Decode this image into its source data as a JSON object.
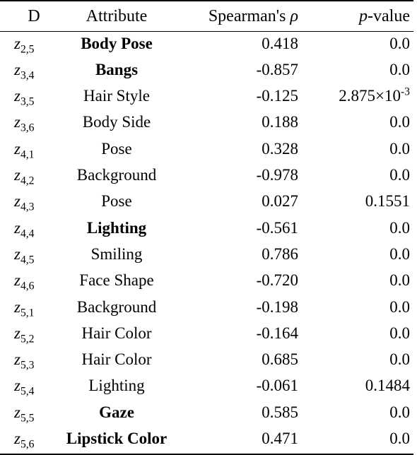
{
  "table": {
    "columns": [
      {
        "key": "dim",
        "label": "D",
        "align": "center"
      },
      {
        "key": "attr",
        "label": "Attribute",
        "align": "center"
      },
      {
        "key": "rho",
        "label": "Spearman's ρ",
        "align": "right"
      },
      {
        "key": "pval",
        "label": "p-value",
        "align": "right"
      }
    ],
    "header": {
      "dim": "D",
      "attribute": "Attribute",
      "spearman_prefix": "Spearman's ",
      "spearman_symbol": "ρ",
      "pvalue_italic": "p",
      "pvalue_rest": "-value"
    },
    "rows": [
      {
        "dim_base": "z",
        "dim_sub": "2,5",
        "attribute": "Body Pose",
        "bold": true,
        "rho": "0.418",
        "pval": "0.0",
        "pval_sci": false
      },
      {
        "dim_base": "z",
        "dim_sub": "3,4",
        "attribute": "Bangs",
        "bold": true,
        "rho": "-0.857",
        "pval": "0.0",
        "pval_sci": false
      },
      {
        "dim_base": "z",
        "dim_sub": "3,5",
        "attribute": "Hair Style",
        "bold": false,
        "rho": "-0.125",
        "pval": "2.875×10⁻³",
        "pval_sci": true,
        "pval_mantissa": "2.875",
        "pval_base": "×10",
        "pval_exp": "-3"
      },
      {
        "dim_base": "z",
        "dim_sub": "3,6",
        "attribute": "Body Side",
        "bold": false,
        "rho": "0.188",
        "pval": "0.0",
        "pval_sci": false
      },
      {
        "dim_base": "z",
        "dim_sub": "4,1",
        "attribute": "Pose",
        "bold": false,
        "rho": "0.328",
        "pval": "0.0",
        "pval_sci": false
      },
      {
        "dim_base": "z",
        "dim_sub": "4,2",
        "attribute": "Background",
        "bold": false,
        "rho": "-0.978",
        "pval": "0.0",
        "pval_sci": false
      },
      {
        "dim_base": "z",
        "dim_sub": "4,3",
        "attribute": "Pose",
        "bold": false,
        "rho": "0.027",
        "pval": "0.1551",
        "pval_sci": false
      },
      {
        "dim_base": "z",
        "dim_sub": "4,4",
        "attribute": "Lighting",
        "bold": true,
        "rho": "-0.561",
        "pval": "0.0",
        "pval_sci": false
      },
      {
        "dim_base": "z",
        "dim_sub": "4,5",
        "attribute": "Smiling",
        "bold": false,
        "rho": "0.786",
        "pval": "0.0",
        "pval_sci": false
      },
      {
        "dim_base": "z",
        "dim_sub": "4,6",
        "attribute": "Face Shape",
        "bold": false,
        "rho": "-0.720",
        "pval": "0.0",
        "pval_sci": false
      },
      {
        "dim_base": "z",
        "dim_sub": "5,1",
        "attribute": "Background",
        "bold": false,
        "rho": "-0.198",
        "pval": "0.0",
        "pval_sci": false
      },
      {
        "dim_base": "z",
        "dim_sub": "5,2",
        "attribute": "Hair Color",
        "bold": false,
        "rho": "-0.164",
        "pval": "0.0",
        "pval_sci": false
      },
      {
        "dim_base": "z",
        "dim_sub": "5,3",
        "attribute": "Hair Color",
        "bold": false,
        "rho": "0.685",
        "pval": "0.0",
        "pval_sci": false
      },
      {
        "dim_base": "z",
        "dim_sub": "5,4",
        "attribute": "Lighting",
        "bold": false,
        "rho": "-0.061",
        "pval": "0.1484",
        "pval_sci": false
      },
      {
        "dim_base": "z",
        "dim_sub": "5,5",
        "attribute": "Gaze",
        "bold": true,
        "rho": "0.585",
        "pval": "0.0",
        "pval_sci": false
      },
      {
        "dim_base": "z",
        "dim_sub": "5,6",
        "attribute": "Lipstick Color",
        "bold": true,
        "rho": "0.471",
        "pval": "0.0",
        "pval_sci": false
      }
    ]
  },
  "style": {
    "text_color": "#000000",
    "background": "#ffffff",
    "rule_color": "#000000"
  }
}
